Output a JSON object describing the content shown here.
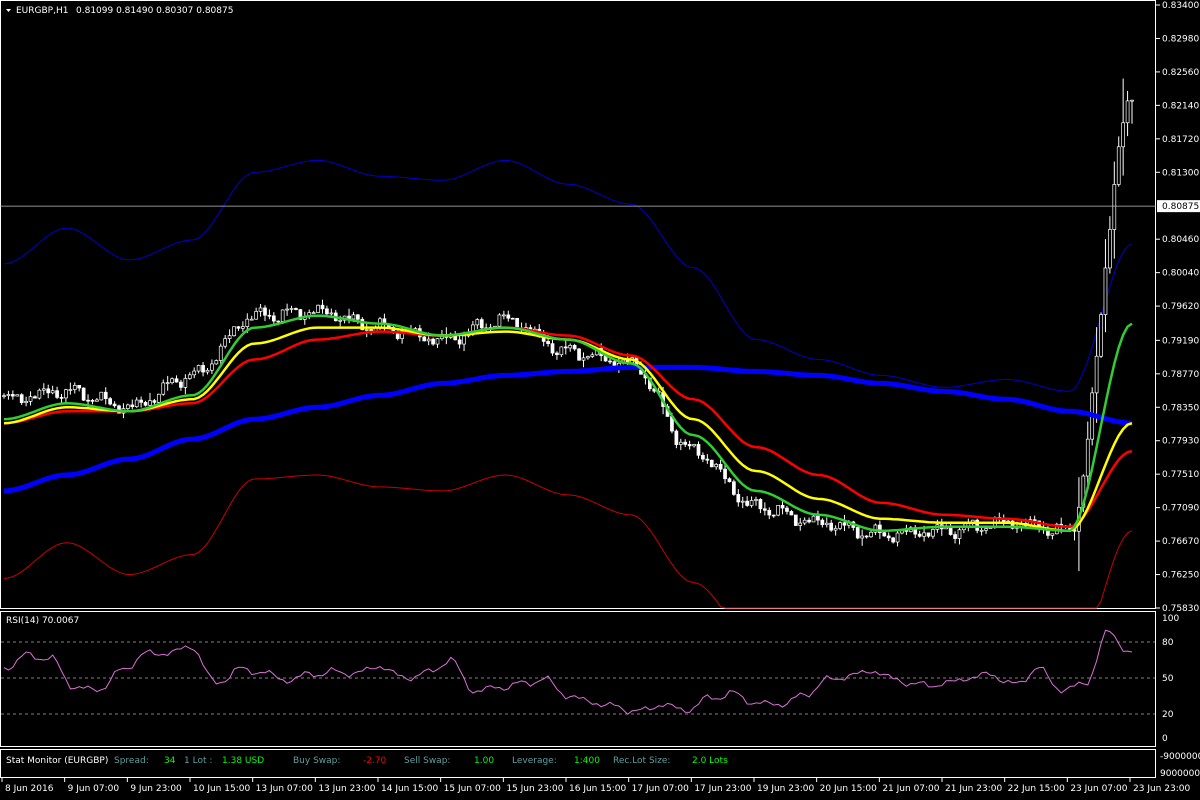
{
  "symbol_header": {
    "symbol": "EURGBP,H1",
    "ohlc": "0.81099 0.81490 0.80307 0.80875"
  },
  "price_axis": {
    "labels": [
      "0.83400",
      "0.82980",
      "0.82560",
      "0.82140",
      "0.81720",
      "0.81300",
      "0.80460",
      "0.80040",
      "0.79620",
      "0.79190",
      "0.78770",
      "0.78350",
      "0.77930",
      "0.77510",
      "0.77090",
      "0.76670",
      "0.76250",
      "0.75830"
    ],
    "current_price": "0.80875"
  },
  "rsi": {
    "title": "RSI(14) 70.0067",
    "levels": [
      "100",
      "80",
      "50",
      "20",
      "0"
    ]
  },
  "stat_monitor": {
    "title": "Stat Monitor (EURGBP)",
    "spread_label": "Spread:",
    "spread_value": "34",
    "lot_label": "1 Lot :",
    "lot_value": "1.38 USD",
    "buy_swap_label": "Buy Swap:",
    "buy_swap_value": "-2.70",
    "sell_swap_label": "Sell Swap:",
    "sell_swap_value": "1.00",
    "leverage_label": "Leverage:",
    "leverage_value": "1:400",
    "rec_lot_label": "Rec.Lot Size:",
    "rec_lot_value": "2.0 Lots",
    "axis_high": "9000000",
    "axis_low": "-9000000"
  },
  "time_axis": {
    "labels": [
      "8 Jun 2016",
      "9 Jun 07:00",
      "9 Jun 23:00",
      "10 Jun 15:00",
      "13 Jun 07:00",
      "13 Jun 23:00",
      "14 Jun 15:00",
      "15 Jun 07:00",
      "15 Jun 23:00",
      "16 Jun 15:00",
      "17 Jun 07:00",
      "17 Jun 23:00",
      "19 Jun 23:00",
      "20 Jun 15:00",
      "21 Jun 07:00",
      "21 Jun 23:00",
      "22 Jun 15:00",
      "23 Jun 07:00",
      "23 Jun 23:00"
    ]
  },
  "colors": {
    "background": "#000000",
    "grid": "#ffffff",
    "candle": "#ffffff",
    "ma_blue": "#0000ff",
    "ma_green": "#32cd32",
    "ma_yellow": "#ffff00",
    "ma_red": "#ff0000",
    "band_upper": "#0000cd",
    "band_lower": "#cc0000",
    "rsi_line": "#da70d6",
    "label_teal": "#5f9ea0",
    "value_green": "#00ff00",
    "value_red": "#ff0000"
  },
  "chart_data": {
    "type": "line",
    "symbol": "EURGBP",
    "timeframe": "H1",
    "ylim": [
      0.7583,
      0.834
    ],
    "x": [
      "8 Jun 2016",
      "9 Jun 07:00",
      "9 Jun 23:00",
      "10 Jun 15:00",
      "13 Jun 07:00",
      "13 Jun 23:00",
      "14 Jun 15:00",
      "15 Jun 07:00",
      "15 Jun 23:00",
      "16 Jun 15:00",
      "17 Jun 07:00",
      "17 Jun 23:00",
      "19 Jun 23:00",
      "20 Jun 15:00",
      "21 Jun 07:00",
      "21 Jun 23:00",
      "22 Jun 15:00",
      "23 Jun 07:00",
      "23 Jun 23:00"
    ],
    "series": [
      {
        "values": [
          0.7845,
          0.7855,
          0.7835,
          0.7875,
          0.795,
          0.7955,
          0.7935,
          0.792,
          0.7945,
          0.7905,
          0.789,
          0.778,
          0.771,
          0.769,
          0.7675,
          0.768,
          0.769,
          0.768,
          0.822
        ]
      },
      {
        "values": [
          0.782,
          0.784,
          0.783,
          0.785,
          0.7935,
          0.795,
          0.794,
          0.7925,
          0.7935,
          0.792,
          0.789,
          0.78,
          0.773,
          0.77,
          0.768,
          0.7685,
          0.7685,
          0.768,
          0.794
        ]
      },
      {
        "values": [
          0.7815,
          0.7835,
          0.783,
          0.7845,
          0.7915,
          0.7935,
          0.7935,
          0.7925,
          0.793,
          0.792,
          0.7895,
          0.782,
          0.7755,
          0.772,
          0.7695,
          0.769,
          0.769,
          0.768,
          0.7815
        ]
      },
      {
        "values": [
          0.7815,
          0.783,
          0.783,
          0.784,
          0.7895,
          0.792,
          0.793,
          0.7925,
          0.7935,
          0.7925,
          0.79,
          0.7845,
          0.7785,
          0.775,
          0.7715,
          0.77,
          0.7695,
          0.7685,
          0.778
        ]
      },
      {
        "values": [
          0.773,
          0.775,
          0.777,
          0.7795,
          0.782,
          0.7835,
          0.785,
          0.7865,
          0.7875,
          0.788,
          0.7885,
          0.7885,
          0.788,
          0.7875,
          0.7865,
          0.7855,
          0.7845,
          0.783,
          0.7815
        ]
      },
      {
        "values": [
          0.8015,
          0.806,
          0.802,
          0.8045,
          0.813,
          0.8145,
          0.8125,
          0.812,
          0.8145,
          0.8115,
          0.809,
          0.801,
          0.792,
          0.7895,
          0.7875,
          0.786,
          0.787,
          0.7855,
          0.804
        ]
      },
      {
        "values": [
          0.762,
          0.7665,
          0.7625,
          0.765,
          0.7745,
          0.775,
          0.7735,
          0.773,
          0.775,
          0.7725,
          0.77,
          0.7615,
          0.754,
          0.752,
          0.751,
          0.751,
          0.75,
          0.75,
          0.768
        ]
      }
    ],
    "current_price": 0.80875,
    "rsi": {
      "name": "RSI(14)",
      "last": 70.0067,
      "ylim": [
        0,
        100
      ],
      "levels": [
        80,
        50,
        20
      ],
      "values": [
        58,
        69,
        66,
        42,
        40,
        56,
        70,
        71,
        76,
        45,
        57,
        55,
        48,
        53,
        55,
        54,
        60,
        50,
        54,
        65,
        39,
        42,
        45,
        49,
        35,
        30,
        26,
        22,
        28,
        23,
        33,
        37,
        29,
        28,
        35,
        48,
        52,
        56,
        48,
        44,
        45,
        50,
        53,
        44,
        58,
        40,
        45,
        88,
        70
      ]
    }
  }
}
